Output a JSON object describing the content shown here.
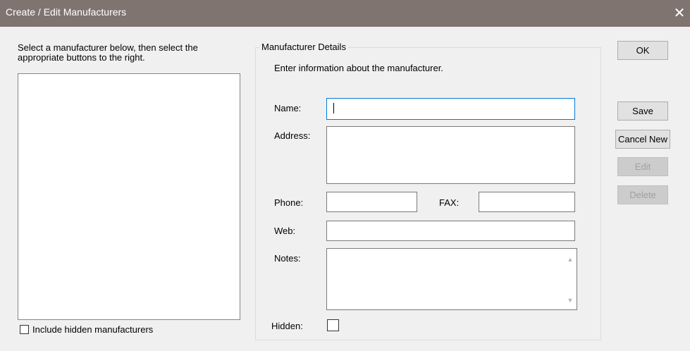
{
  "window": {
    "title": "Create / Edit Manufacturers",
    "close_glyph": "✕"
  },
  "left_panel": {
    "instruction": "Select a manufacturer below, then select the appropriate buttons to the right.",
    "manufacturer_list": [],
    "include_hidden_label": "Include hidden manufacturers",
    "include_hidden_checked": false
  },
  "details": {
    "group_title": "Manufacturer Details",
    "info_text": "Enter information about the manufacturer.",
    "name_label": "Name:",
    "name_value": "",
    "address_label": "Address:",
    "address_value": "",
    "phone_label": "Phone:",
    "phone_value": "",
    "fax_label": "FAX:",
    "fax_value": "",
    "web_label": "Web:",
    "web_value": "",
    "notes_label": "Notes:",
    "notes_value": "",
    "hidden_label": "Hidden:",
    "hidden_checked": false
  },
  "buttons": {
    "ok": "OK",
    "save": "Save",
    "cancel_new": "Cancel New",
    "edit": "Edit",
    "delete": "Delete"
  },
  "icons": {
    "close": "close-icon",
    "scroll_up": "chevron-up-icon",
    "scroll_down": "chevron-down-icon"
  }
}
